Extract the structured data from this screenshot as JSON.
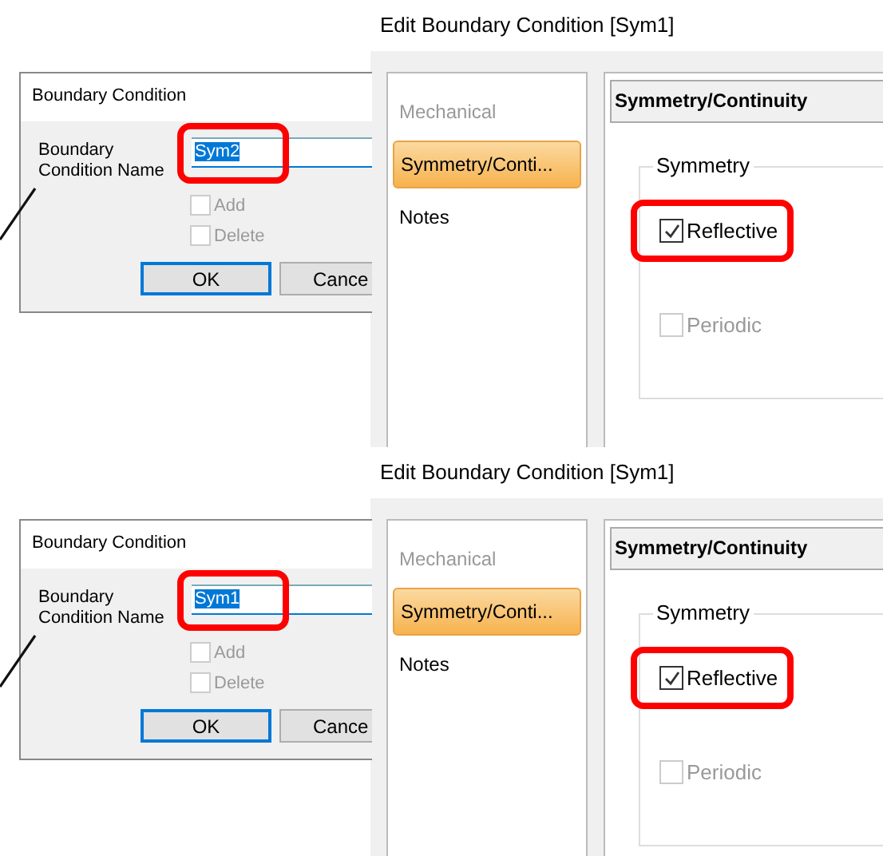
{
  "panels": [
    {
      "name_dialog": {
        "title": "Boundary Condition",
        "field": {
          "label": "Boundary Condition Name",
          "value": "Sym2",
          "text_selected": true,
          "highlighted": true
        },
        "options": [
          {
            "label": "Add",
            "checked": false,
            "disabled": true
          },
          {
            "label": "Delete",
            "checked": false,
            "disabled": true
          }
        ],
        "buttons": [
          {
            "label": "OK",
            "default": true
          },
          {
            "label": "Cance",
            "default": false
          }
        ]
      },
      "edit_dialog": {
        "title": "Edit Boundary Condition [Sym1]",
        "nav": [
          {
            "label": "Mechanical",
            "selected": false,
            "disabled": true
          },
          {
            "label": "Symmetry/Conti...",
            "selected": true,
            "disabled": false
          },
          {
            "label": "Notes",
            "selected": false,
            "disabled": false
          }
        ],
        "section_title": "Symmetry/Continuity",
        "group": {
          "title": "Symmetry",
          "options": [
            {
              "label": "Reflective",
              "checked": true,
              "disabled": false,
              "highlighted": true
            },
            {
              "label": "Periodic",
              "checked": false,
              "disabled": true,
              "highlighted": false
            }
          ]
        }
      }
    },
    {
      "name_dialog": {
        "title": "Boundary Condition",
        "field": {
          "label": "Boundary Condition Name",
          "value": "Sym1",
          "text_selected": true,
          "highlighted": true
        },
        "options": [
          {
            "label": "Add",
            "checked": false,
            "disabled": true
          },
          {
            "label": "Delete",
            "checked": false,
            "disabled": true
          }
        ],
        "buttons": [
          {
            "label": "OK",
            "default": true
          },
          {
            "label": "Cance",
            "default": false
          }
        ]
      },
      "edit_dialog": {
        "title": "Edit Boundary Condition [Sym1]",
        "nav": [
          {
            "label": "Mechanical",
            "selected": false,
            "disabled": true
          },
          {
            "label": "Symmetry/Conti...",
            "selected": true,
            "disabled": false
          },
          {
            "label": "Notes",
            "selected": false,
            "disabled": false
          }
        ],
        "section_title": "Symmetry/Continuity",
        "group": {
          "title": "Symmetry",
          "options": [
            {
              "label": "Reflective",
              "checked": true,
              "disabled": false,
              "highlighted": true
            },
            {
              "label": "Periodic",
              "checked": false,
              "disabled": true,
              "highlighted": false
            }
          ]
        }
      }
    }
  ]
}
